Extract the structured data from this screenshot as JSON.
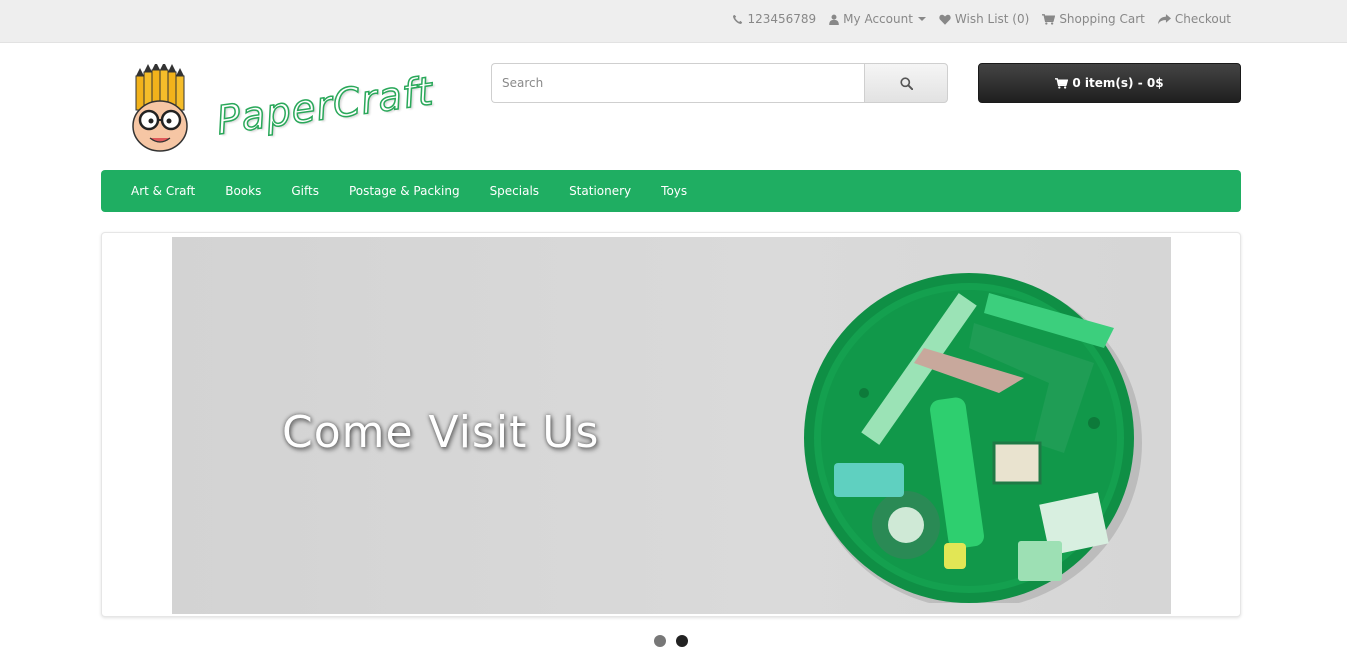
{
  "topbar": {
    "phone": "123456789",
    "my_account": "My Account",
    "wish_list": "Wish List (0)",
    "shopping_cart": "Shopping Cart",
    "checkout": "Checkout"
  },
  "logo": {
    "text": "PaperCraft"
  },
  "search": {
    "placeholder": "Search"
  },
  "cart": {
    "label": "0 item(s) - 0$"
  },
  "nav": {
    "items": [
      "Art & Craft",
      "Books",
      "Gifts",
      "Postage & Packing",
      "Specials",
      "Stationery",
      "Toys"
    ]
  },
  "slideshow": {
    "title": "Come Visit Us",
    "slide_count": 2,
    "active_slide": 2
  },
  "colors": {
    "nav_bg": "#1fae62",
    "topbar_bg": "#eeeeee",
    "cart_bg": "#222222"
  },
  "icons": [
    "phone-icon",
    "user-icon",
    "heart-icon",
    "cart-icon",
    "share-icon",
    "search-icon"
  ]
}
